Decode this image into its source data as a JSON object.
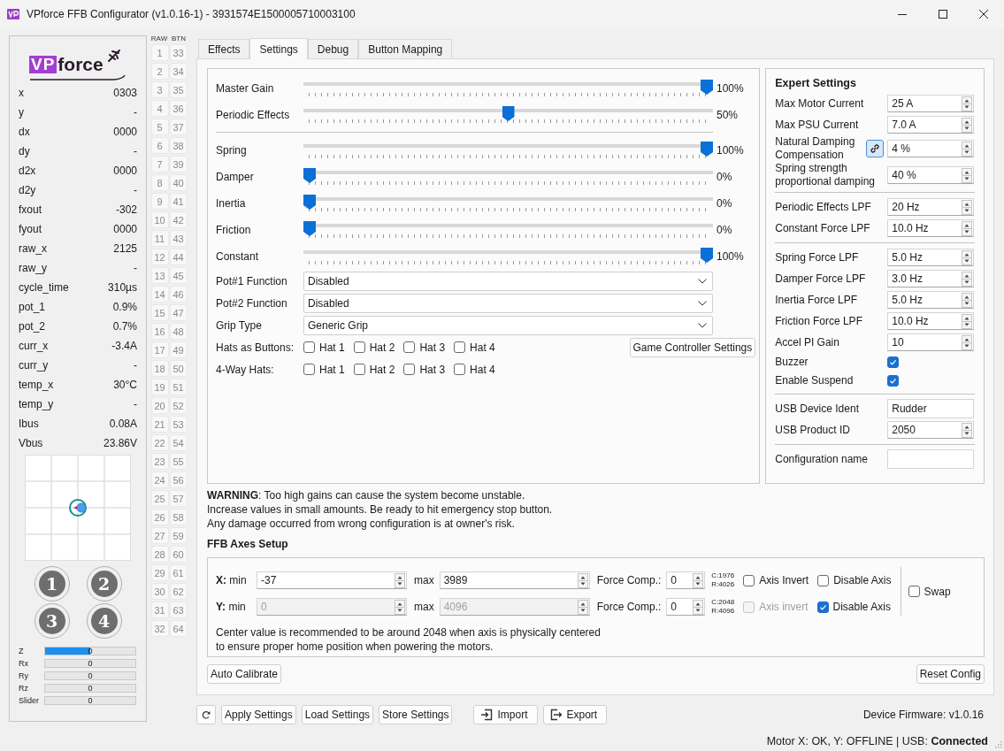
{
  "window": {
    "title": "VPforce FFB Configurator (v1.0.16-1) - 3931574E1500005710003100"
  },
  "monitor": {
    "logo": {
      "badge": "VP",
      "text": "force"
    },
    "readings": [
      {
        "label": "x",
        "value": "0303"
      },
      {
        "label": "y",
        "value": "-"
      },
      {
        "label": "dx",
        "value": "0000"
      },
      {
        "label": "dy",
        "value": "-"
      },
      {
        "label": "d2x",
        "value": "0000"
      },
      {
        "label": "d2y",
        "value": "-"
      },
      {
        "label": "fxout",
        "value": "-302"
      },
      {
        "label": "fyout",
        "value": "0000"
      },
      {
        "label": "raw_x",
        "value": "2125"
      },
      {
        "label": "raw_y",
        "value": "-"
      },
      {
        "label": "cycle_time",
        "value": "310µs"
      },
      {
        "label": "pot_1",
        "value": "0.9%"
      },
      {
        "label": "pot_2",
        "value": "0.7%"
      },
      {
        "label": "curr_x",
        "value": "-3.4A"
      },
      {
        "label": "curr_y",
        "value": "-"
      },
      {
        "label": "temp_x",
        "value": "30°C"
      },
      {
        "label": "temp_y",
        "value": "-"
      },
      {
        "label": "Ibus",
        "value": "0.08A"
      },
      {
        "label": "Vbus",
        "value": "23.86V"
      }
    ],
    "round_buttons": [
      "1",
      "2",
      "3",
      "4"
    ],
    "axes": [
      {
        "label": "Z",
        "value": "0",
        "level": 0.5
      },
      {
        "label": "Rx",
        "value": "0",
        "level": 0
      },
      {
        "label": "Ry",
        "value": "0",
        "level": 0
      },
      {
        "label": "Rz",
        "value": "0",
        "level": 0
      },
      {
        "label": "Slider",
        "value": "0",
        "level": 0
      }
    ]
  },
  "button_grid": {
    "headers": [
      "RAW",
      "BTN"
    ],
    "columns": [
      [
        "1",
        "2",
        "3",
        "4",
        "5",
        "6",
        "7",
        "8",
        "9",
        "10",
        "11",
        "12",
        "13",
        "14",
        "15",
        "16",
        "17",
        "18",
        "19",
        "20",
        "21",
        "22",
        "23",
        "24",
        "25",
        "26",
        "27",
        "28",
        "29",
        "30",
        "31",
        "32"
      ],
      [
        "33",
        "34",
        "35",
        "36",
        "37",
        "38",
        "39",
        "40",
        "41",
        "42",
        "43",
        "44",
        "45",
        "46",
        "47",
        "48",
        "49",
        "50",
        "51",
        "52",
        "53",
        "54",
        "55",
        "56",
        "57",
        "58",
        "59",
        "60",
        "61",
        "62",
        "63",
        "64"
      ]
    ]
  },
  "tabs": [
    {
      "label": "Effects",
      "selected": false
    },
    {
      "label": "Settings",
      "selected": true
    },
    {
      "label": "Debug",
      "selected": false
    },
    {
      "label": "Button Mapping",
      "selected": false
    }
  ],
  "settings": {
    "gain_sliders": [
      {
        "label": "Master Gain",
        "level": 1,
        "reading": "100%"
      },
      {
        "label": "Periodic Effects",
        "level": 0.5,
        "reading": "50%"
      }
    ],
    "effect_sliders": [
      {
        "label": "Spring",
        "level": 1,
        "reading": "100%"
      },
      {
        "label": "Damper",
        "level": 0,
        "reading": "0%"
      },
      {
        "label": "Inertia",
        "level": 0,
        "reading": "0%"
      },
      {
        "label": "Friction",
        "level": 0,
        "reading": "0%"
      },
      {
        "label": "Constant",
        "level": 1,
        "reading": "100%"
      }
    ],
    "dropdowns": [
      {
        "label": "Pot#1 Function",
        "value": "Disabled"
      },
      {
        "label": "Pot#2 Function",
        "value": "Disabled"
      },
      {
        "label": "Grip Type",
        "value": "Generic Grip"
      }
    ],
    "hat_rows": [
      {
        "label": "Hats as Buttons:",
        "hats": [
          {
            "label": "Hat 1",
            "checked": false
          },
          {
            "label": "Hat 2",
            "checked": false
          },
          {
            "label": "Hat 3",
            "checked": false
          },
          {
            "label": "Hat 4",
            "checked": false
          }
        ]
      },
      {
        "label": "4-Way Hats:",
        "hats": [
          {
            "label": "Hat 1",
            "checked": false
          },
          {
            "label": "Hat 2",
            "checked": false
          },
          {
            "label": "Hat 3",
            "checked": false
          },
          {
            "label": "Hat 4",
            "checked": false
          }
        ]
      }
    ],
    "game_controller_button": "Game Controller Settings"
  },
  "expert": {
    "title": "Expert Settings",
    "groups": [
      [
        {
          "label": "Max Motor Current",
          "kind": "spin",
          "value": "25 A"
        },
        {
          "label": "Max PSU Current",
          "kind": "spin",
          "value": "7.0 A"
        },
        {
          "label": "Natural Damping Compensation",
          "kind": "linked-spin",
          "value": "4 %"
        },
        {
          "label": "Spring strength proportional damping",
          "kind": "spin",
          "value": "40 %"
        }
      ],
      [
        {
          "label": "Periodic Effects LPF",
          "kind": "spin",
          "value": "20 Hz"
        },
        {
          "label": "Constant Force LPF",
          "kind": "spin",
          "value": "10.0 Hz"
        }
      ],
      [
        {
          "label": "Spring Force LPF",
          "kind": "spin",
          "value": "5.0 Hz"
        },
        {
          "label": "Damper Force LPF",
          "kind": "spin",
          "value": "3.0 Hz"
        },
        {
          "label": "Inertia Force LPF",
          "kind": "spin",
          "value": "5.0 Hz"
        },
        {
          "label": "Friction Force LPF",
          "kind": "spin",
          "value": "10.0 Hz"
        },
        {
          "label": "Accel PI Gain",
          "kind": "spin",
          "value": "10"
        },
        {
          "label": "Buzzer",
          "kind": "check",
          "checked": true
        },
        {
          "label": "Enable Suspend",
          "kind": "check",
          "checked": true
        }
      ],
      [
        {
          "label": "USB Device Ident",
          "kind": "text",
          "value": "Rudder"
        },
        {
          "label": "USB Product ID",
          "kind": "spin",
          "value": "2050"
        }
      ],
      [
        {
          "label": "Configuration name",
          "kind": "text"
        }
      ]
    ]
  },
  "warning": [
    "**WARNING**: Too high gains can cause the system become unstable.",
    "Increase values in small amounts. Be ready to hit emergency stop button.",
    "Any damage occurred from wrong configuration is at owner's risk."
  ],
  "axes_setup": {
    "title": "FFB Axes Setup",
    "rows": [
      {
        "label": "**X:** min",
        "min": "-37",
        "max_label": "max",
        "max": "3989",
        "force_label": "Force Comp.:",
        "force": "0",
        "calibration": [
          "C:1976",
          "R:4026"
        ],
        "disabled": false,
        "invert": {
          "label": "Axis Invert",
          "checked": false,
          "disabled": false
        },
        "disable_axis": {
          "label": "Disable Axis",
          "checked": false
        }
      },
      {
        "label": "**Y:** min",
        "min": "0",
        "max_label": "max",
        "max": "4096",
        "force_label": "Force Comp.:",
        "force": "0",
        "calibration": [
          "C:2048",
          "R:4096"
        ],
        "disabled": true,
        "invert": {
          "label": "Axis invert",
          "checked": false,
          "disabled": true
        },
        "disable_axis": {
          "label": "Disable Axis",
          "checked": true
        }
      }
    ],
    "swap": {
      "label": "Swap",
      "checked": false
    },
    "note": [
      "Center value is recommended to be around 2048 when axis is physically centered",
      "to ensure proper home position when powering the motors."
    ]
  },
  "auto_calibrate": "Auto Calibrate",
  "reset_config": "Reset Config",
  "toolbar": {
    "buttons": [
      {
        "kind": "refresh"
      },
      {
        "kind": "text",
        "label": "Apply Settings"
      },
      {
        "kind": "text",
        "label": "Load Settings"
      },
      {
        "kind": "text",
        "label": "Store Settings"
      },
      {
        "kind": "import",
        "label": "Import"
      },
      {
        "kind": "export",
        "label": "Export"
      }
    ],
    "firmware": "Device Firmware:  v1.0.16"
  },
  "status_bar": "Motor X: OK, Y: OFFLINE | USB: **Connected**"
}
